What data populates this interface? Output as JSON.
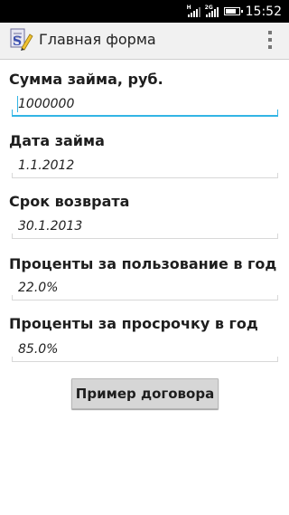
{
  "status_bar": {
    "time": "15:52",
    "network_tags": [
      "H",
      "2G"
    ],
    "battery_level": 0.85
  },
  "action_bar": {
    "title": "Главная форма",
    "app_icon": "document-pencil-icon",
    "overflow_icon": "overflow-menu-icon"
  },
  "form": {
    "fields": [
      {
        "label": "Сумма займа, руб.",
        "value": "1000000"
      },
      {
        "label": "Дата займа",
        "value": "1.1.2012"
      },
      {
        "label": "Срок возврата",
        "value": "30.1.2013"
      },
      {
        "label": "Проценты за пользование в год",
        "value": "22.0%"
      },
      {
        "label": "Проценты за просрочку в год",
        "value": "85.0%"
      }
    ],
    "example_button": "Пример договора"
  },
  "colors": {
    "focus_accent": "#33b5e5",
    "status_bar": "#000000",
    "action_bar": "#f1f1f1"
  }
}
